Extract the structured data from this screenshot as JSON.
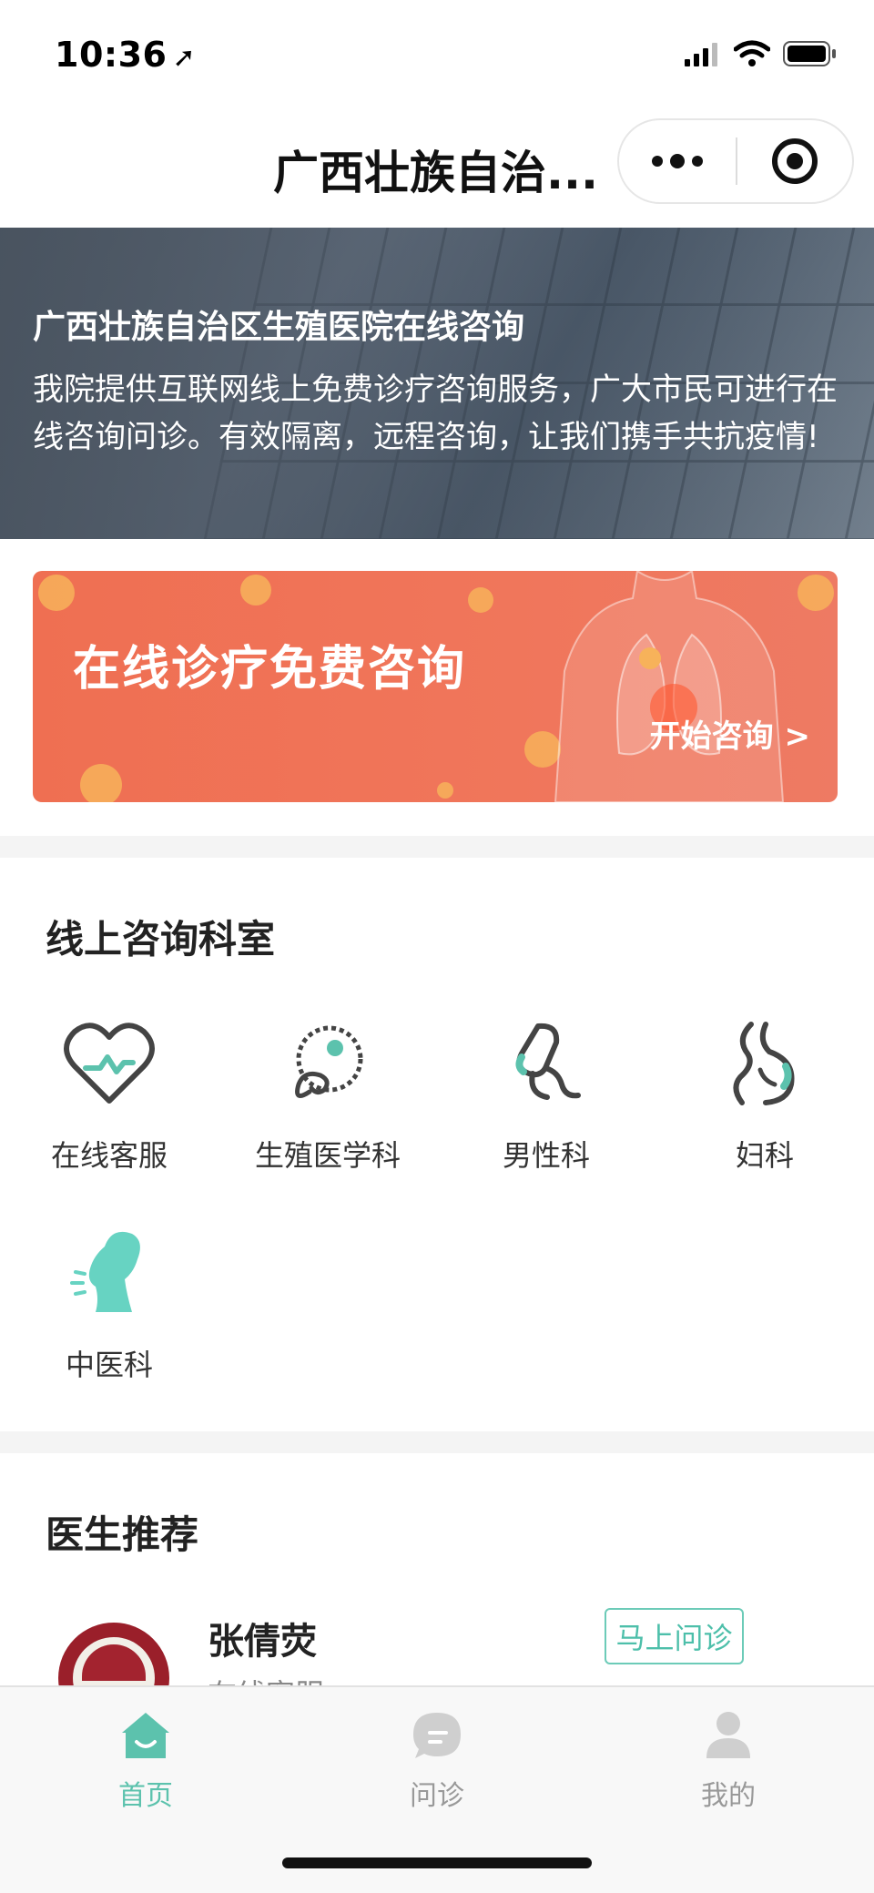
{
  "status_bar": {
    "time": "10:36",
    "location_arrow": "➚"
  },
  "nav": {
    "title": "广西壮族自治..."
  },
  "hero": {
    "title": "广西壮族自治区生殖医院在线咨询",
    "description": "我院提供互联网线上免费诊疗咨询服务，广大市民可进行在线咨询问诊。有效隔离，远程咨询，让我们携手共抗疫情!"
  },
  "promo": {
    "title": "在线诊疗免费咨询",
    "cta": "开始咨询 >"
  },
  "departments": {
    "section_title": "线上咨询科室",
    "items": [
      {
        "label": "在线客服",
        "icon": "heart-icon"
      },
      {
        "label": "生殖医学科",
        "icon": "reproductive-icon"
      },
      {
        "label": "男性科",
        "icon": "male-icon"
      },
      {
        "label": "妇科",
        "icon": "gynecology-icon"
      },
      {
        "label": "中医科",
        "icon": "tcm-icon"
      }
    ]
  },
  "doctors": {
    "section_title": "医生推荐",
    "items": [
      {
        "name": "张倩荧",
        "department": "在线客服",
        "button": "马上问诊"
      }
    ]
  },
  "tab_bar": {
    "items": [
      {
        "label": "首页",
        "icon": "home-icon",
        "active": true
      },
      {
        "label": "问诊",
        "icon": "chat-icon",
        "active": false
      },
      {
        "label": "我的",
        "icon": "user-icon",
        "active": false
      }
    ]
  },
  "colors": {
    "accent": "#5cc2ad",
    "promo": "#ef6f52",
    "separator": "#f4f4f4"
  }
}
